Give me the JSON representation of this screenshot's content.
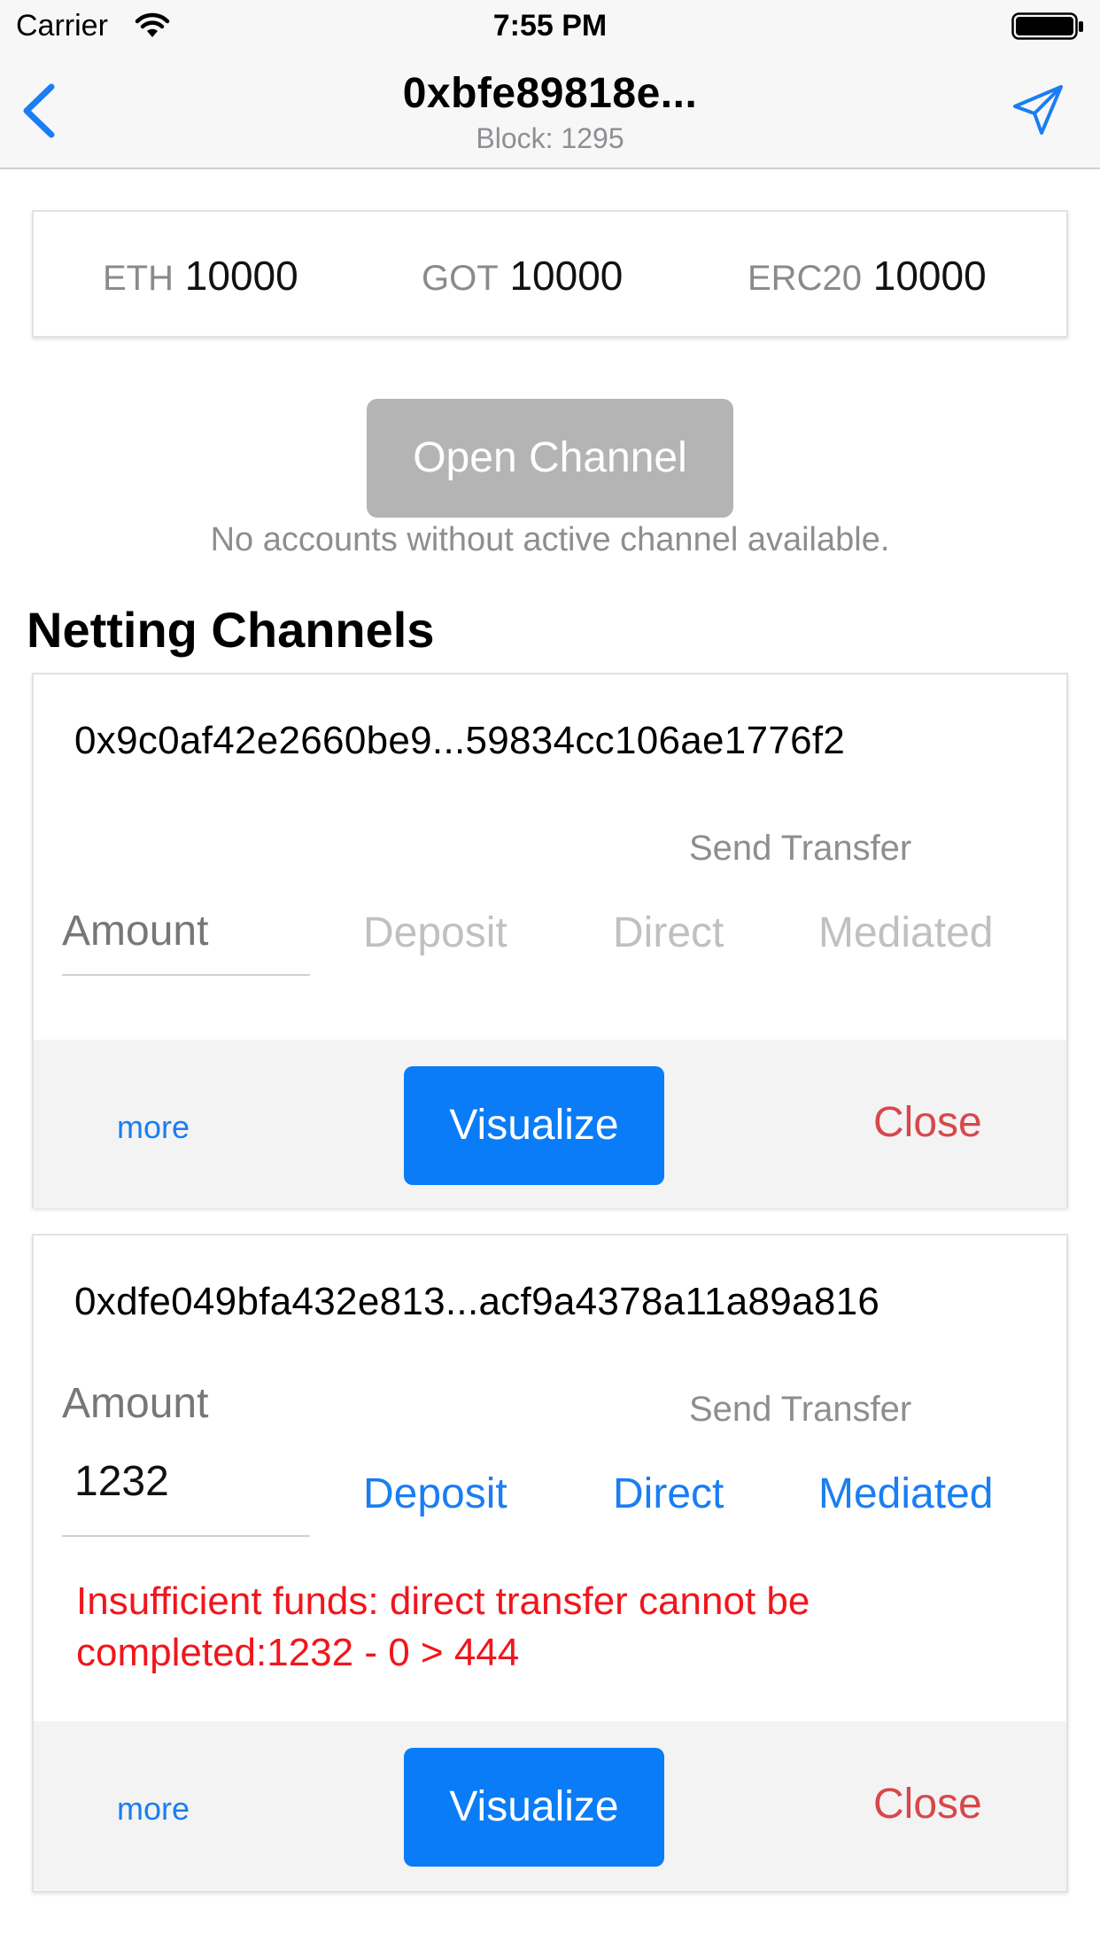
{
  "status_bar": {
    "carrier": "Carrier",
    "time": "7:55 PM"
  },
  "nav": {
    "title": "0xbfe89818e...",
    "subtitle": "Block: 1295",
    "back_icon": "chevron-left-icon",
    "send_icon": "paper-plane-icon",
    "tint": "#1a7ef2"
  },
  "balances": [
    {
      "token": "ETH",
      "value": "10000"
    },
    {
      "token": "GOT",
      "value": "10000"
    },
    {
      "token": "ERC20",
      "value": "10000"
    }
  ],
  "open_channel": {
    "label": "Open Channel",
    "note": "No accounts without active channel available.",
    "disabled": true
  },
  "section_title": "Netting Channels",
  "channels": [
    {
      "address": "0x9c0af42e2660be9...59834cc106ae1776f2",
      "send_transfer_label": "Send Transfer",
      "amount_placeholder": "Amount",
      "amount_value": "",
      "deposit_label": "Deposit",
      "direct_label": "Direct",
      "mediated_label": "Mediated",
      "actions_enabled": false,
      "error": "",
      "more_label": "more",
      "visualize_label": "Visualize",
      "close_label": "Close"
    },
    {
      "address": "0xdfe049bfa432e813...acf9a4378a11a89a816",
      "send_transfer_label": "Send Transfer",
      "amount_placeholder": "Amount",
      "amount_value": "1232",
      "deposit_label": "Deposit",
      "direct_label": "Direct",
      "mediated_label": "Mediated",
      "actions_enabled": true,
      "error": "Insufficient funds: direct transfer cannot be completed:1232 - 0 > 444",
      "more_label": "more",
      "visualize_label": "Visualize",
      "close_label": "Close"
    }
  ],
  "colors": {
    "accent": "#0a7cf7",
    "link": "#1a7ef2",
    "close": "#d8474b",
    "error": "#f0161c",
    "disabled_button": "#b4b4b4"
  }
}
